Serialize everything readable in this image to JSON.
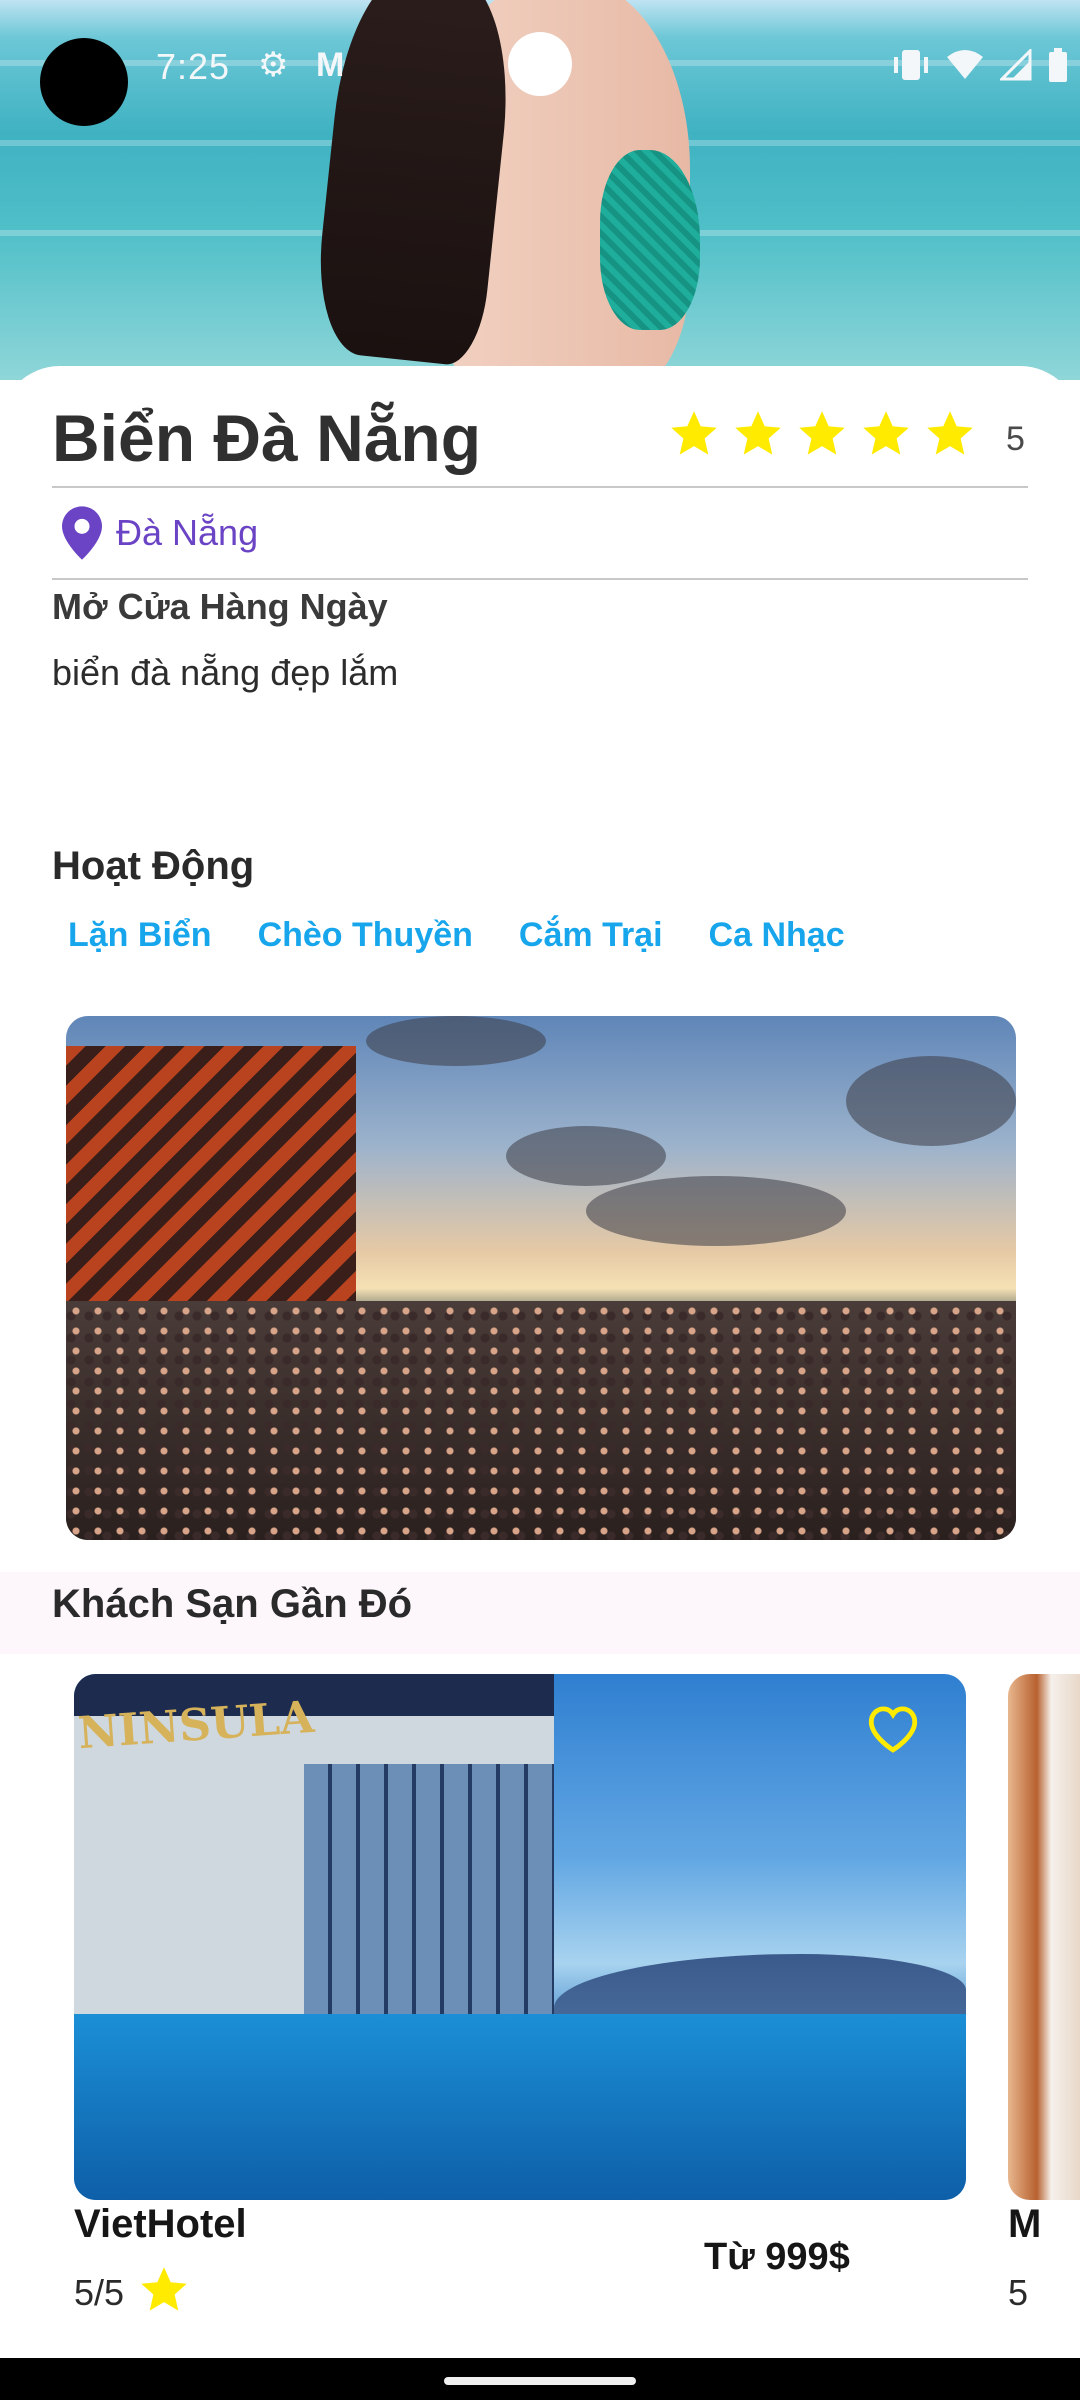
{
  "status_bar": {
    "time": "7:25",
    "icons_left": [
      "settings-icon",
      "gmail-icon"
    ],
    "icons_right": [
      "vibrate-icon",
      "wifi-icon",
      "signal-icon",
      "battery-icon"
    ]
  },
  "place": {
    "title": "Biển Đà Nẵng",
    "rating": "5",
    "rating_stars": 5,
    "location": "Đà Nẵng",
    "open_hours": "Mở Cửa Hàng Ngày",
    "description": "biển đà nẵng đẹp lắm"
  },
  "activities": {
    "title": "Hoạt Động",
    "tabs": [
      "Lặn Biển",
      "Chèo Thuyền",
      "Cắm Trại",
      "Ca Nhạc"
    ]
  },
  "nearby_hotels": {
    "title": "Khách Sạn Gần Đó",
    "items": [
      {
        "name": "VietHotel",
        "price": "Từ 999$",
        "rating": "5/5",
        "sign": "NINSULA",
        "favorite": false
      },
      {
        "name": "M",
        "rating": "5"
      }
    ]
  },
  "colors": {
    "star": "#FFEB00",
    "location": "#6A44C4",
    "activity_tab": "#17A6EC",
    "heart": "#FFEB00"
  }
}
